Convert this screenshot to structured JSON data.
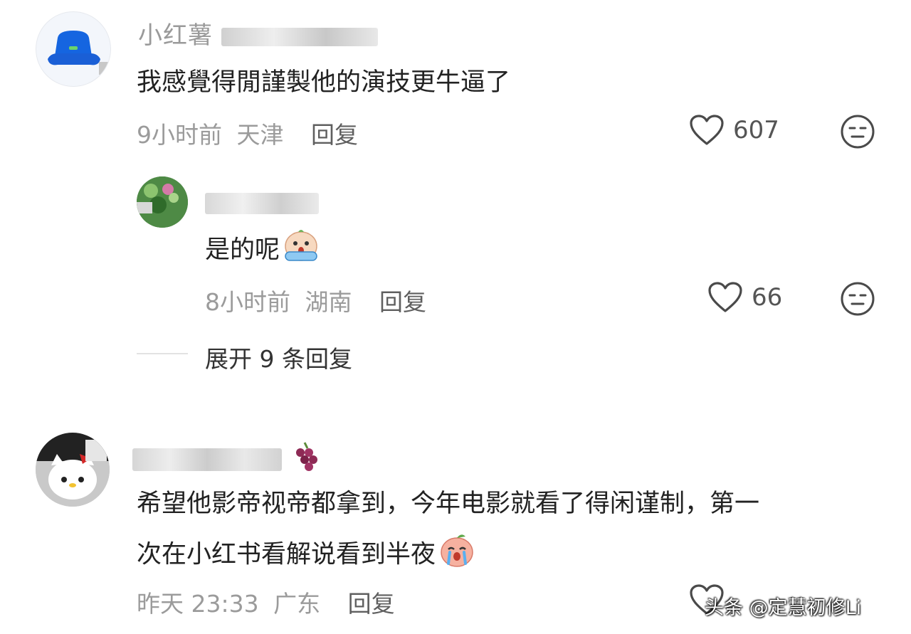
{
  "comments": [
    {
      "username": "小红薯",
      "text": "我感覺得閒謹製他的演技更牛逼了",
      "time": "9小时前",
      "location": "天津",
      "reply_label": "回复",
      "likes": "607",
      "avatar_icon": "bucket-hat-avatar-icon"
    },
    {
      "text_line1": "希望他影帝视帝都拿到，今年电影就看了得闲谨制，第一",
      "text_line2": "次在小红书看解说看到半夜",
      "time": "昨天 23:33",
      "location": "广东",
      "reply_label": "回复",
      "avatar_icon": "hello-kitty-avatar-icon"
    }
  ],
  "reply": {
    "text": "是的呢",
    "time": "8小时前",
    "location": "湖南",
    "reply_label": "回复",
    "likes": "66",
    "avatar_icon": "plant-avatar-icon"
  },
  "expand_label": "展开 9 条回复",
  "watermark": "头条 @定慧初修Li",
  "colors": {
    "meta": "#9b9b9b",
    "text": "#222222",
    "icon": "#555555"
  }
}
